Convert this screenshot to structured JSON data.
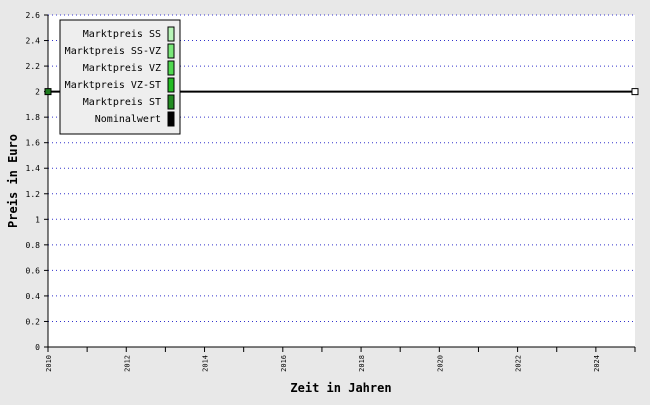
{
  "chart_data": {
    "type": "line",
    "xlabel": "Zeit in Jahren",
    "ylabel": "Preis in Euro",
    "x_ticks": [
      2010,
      2012,
      2014,
      2016,
      2018,
      2020,
      2022,
      2024
    ],
    "xlim": [
      2010,
      2025
    ],
    "ylim": [
      0,
      2.6
    ],
    "y_ticks": [
      "0",
      "0.2",
      "0.4",
      "0.6",
      "0.8",
      "1",
      "1.2",
      "1.4",
      "1.6",
      "1.8",
      "2",
      "2.2",
      "2.4",
      "2.6"
    ],
    "grid": "horizontal-dotted",
    "legend_position": "top-left",
    "series": [
      {
        "name": "Marktpreis SS",
        "color": "#b8f4b8",
        "x": [
          2010
        ],
        "y": [
          2
        ]
      },
      {
        "name": "Marktpreis SS-VZ",
        "color": "#7ae87a",
        "x": [
          2010
        ],
        "y": [
          2
        ]
      },
      {
        "name": "Marktpreis VZ",
        "color": "#4fd84f",
        "x": [
          2010
        ],
        "y": [
          2
        ]
      },
      {
        "name": "Marktpreis VZ-ST",
        "color": "#22bb22",
        "x": [
          2010
        ],
        "y": [
          2
        ]
      },
      {
        "name": "Marktpreis ST",
        "color": "#228b22",
        "x": [
          2010
        ],
        "y": [
          2
        ]
      },
      {
        "name": "Nominalwert",
        "color": "#000000",
        "x": [
          2010,
          2025
        ],
        "y": [
          2,
          2
        ]
      }
    ]
  }
}
